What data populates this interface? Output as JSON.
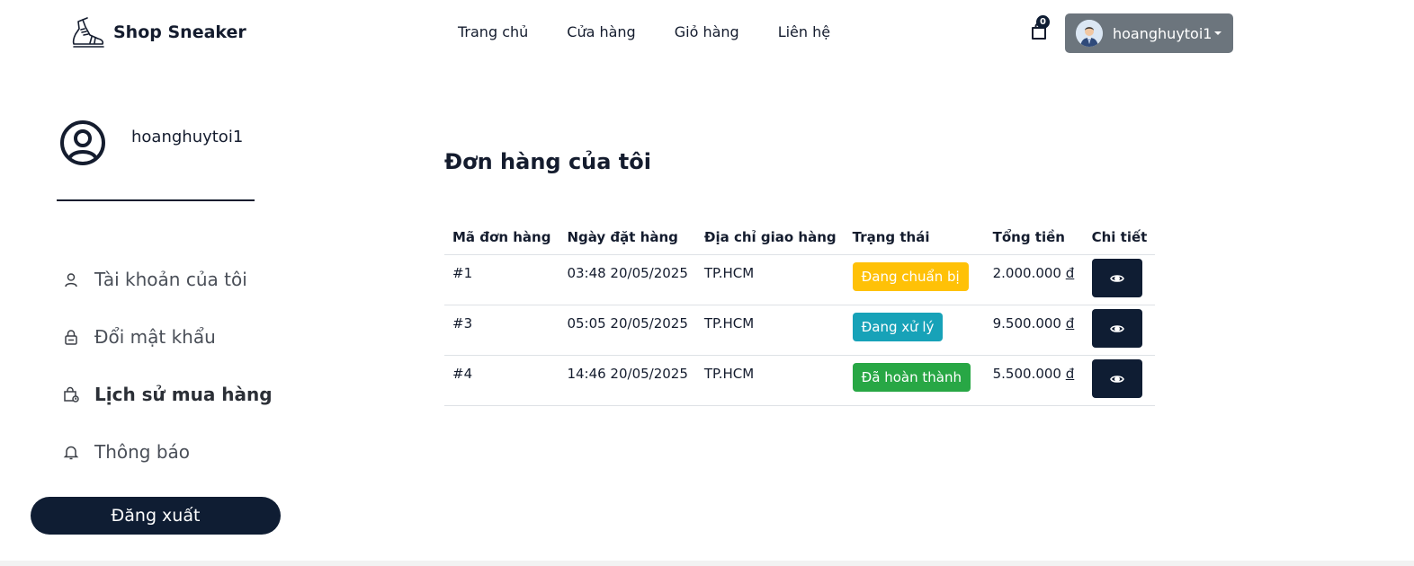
{
  "header": {
    "brand": "Shop Sneaker",
    "nav": [
      "Trang chủ",
      "Cửa hàng",
      "Giỏ hàng",
      "Liên hệ"
    ],
    "cart_count": "0",
    "username": "hoanghuytoi1"
  },
  "sidebar": {
    "username": "hoanghuytoi1",
    "items": [
      {
        "label": "Tài khoản của tôi",
        "icon": "user-icon"
      },
      {
        "label": "Đổi mật khẩu",
        "icon": "lock-icon"
      },
      {
        "label": "Lịch sử mua hàng",
        "icon": "shopping-bag-clock-icon"
      },
      {
        "label": "Thông báo",
        "icon": "bell-icon"
      }
    ],
    "active_index": 2,
    "logout_label": "Đăng xuất"
  },
  "main": {
    "title": "Đơn hàng của tôi",
    "columns": [
      "Mã đơn hàng",
      "Ngày đặt hàng",
      "Địa chỉ giao hàng",
      "Trạng thái",
      "Tổng tiền",
      "Chi tiết"
    ],
    "currency_symbol": "đ",
    "orders": [
      {
        "id": "#1",
        "date": "03:48 20/05/2025",
        "address": "TP.HCM",
        "status": "Đang chuẩn bị",
        "status_color": "#ffc107",
        "total": "2.000.000"
      },
      {
        "id": "#3",
        "date": "05:05 20/05/2025",
        "address": "TP.HCM",
        "status": "Đang xử lý",
        "status_color": "#17a2b8",
        "total": "9.500.000"
      },
      {
        "id": "#4",
        "date": "14:46 20/05/2025",
        "address": "TP.HCM",
        "status": "Đã hoàn thành",
        "status_color": "#28a745",
        "total": "5.500.000"
      }
    ]
  },
  "colors": {
    "primary": "#0f1d33",
    "user_button": "#6c757d"
  }
}
